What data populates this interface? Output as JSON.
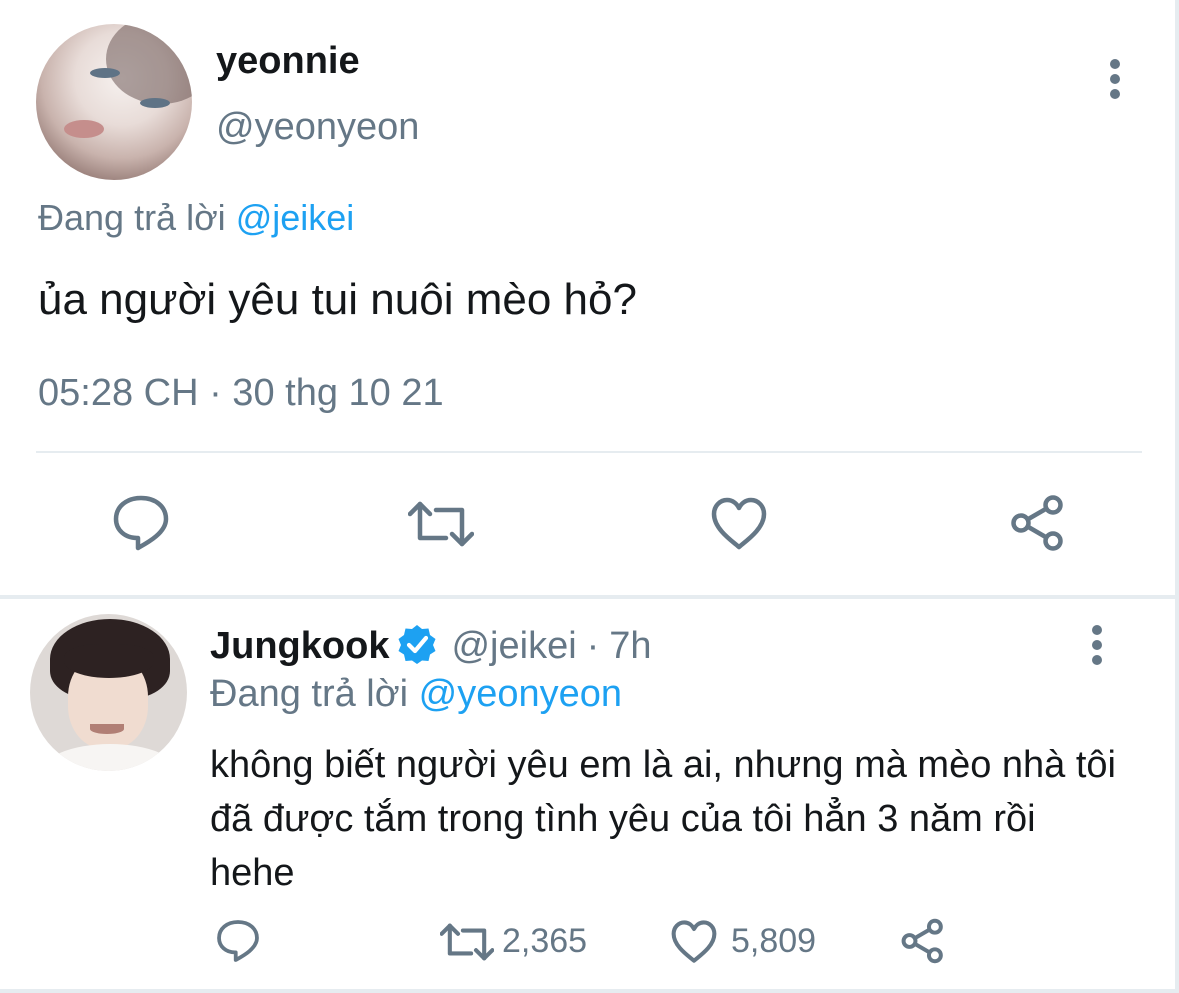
{
  "main_tweet": {
    "display_name": "yeonnie",
    "handle": "@yeonyeon",
    "replying_prefix": "Đang trả lời",
    "replying_to": "@jeikei",
    "text": "ủa người yêu tui nuôi mèo hỏ?",
    "timestamp": "05:28 CH · 30 thg 10 21",
    "icons": {
      "more": "more-vertical-icon",
      "reply": "reply-icon",
      "retweet": "retweet-icon",
      "like": "heart-icon",
      "share": "share-icon"
    }
  },
  "reply_tweet": {
    "display_name": "Jungkook",
    "verified_icon": "verified-badge-icon",
    "handle": "@jeikei",
    "separator": "·",
    "time": "7h",
    "replying_prefix": "Đang trả lời",
    "replying_to": "@yeonyeon",
    "text": "không biết người yêu em là ai, nhưng mà mèo nhà tôi đã được tắm trong tình yêu của tôi hẳn 3 năm rồi hehe",
    "retweet_count": "2,365",
    "like_count": "5,809"
  },
  "colors": {
    "text_primary": "#14171a",
    "text_secondary": "#657786",
    "accent": "#1da1f2",
    "divider": "#e6ecf0",
    "background": "#ffffff"
  }
}
